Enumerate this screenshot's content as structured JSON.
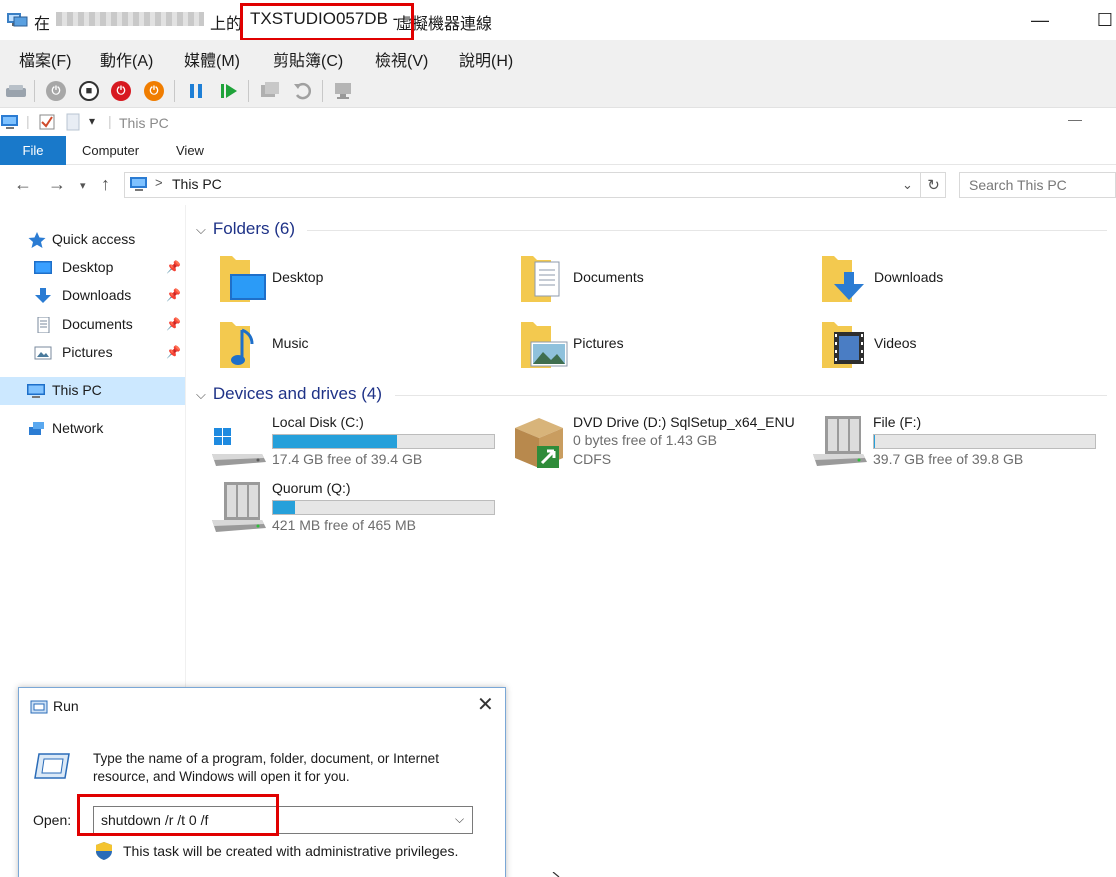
{
  "vm_window": {
    "title_prefix": "在",
    "title_on": "上的",
    "title_machine": "TXSTUDIO057DB -",
    "title_suffix": "虛擬機器連線",
    "minimize_glyph": "—",
    "maximize_glyph": "☐"
  },
  "vm_menu": [
    "檔案(F)",
    "動作(A)",
    "媒體(M)",
    "剪貼簿(C)",
    "檢視(V)",
    "說明(H)"
  ],
  "vm_toolbar": {
    "icons": [
      "ctrl-alt-del-icon",
      "start-icon",
      "turn-off-icon",
      "shutdown-icon",
      "power-icon",
      "pause-icon",
      "resume-icon",
      "checkpoint-icon",
      "revert-icon",
      "enhanced-session-icon"
    ],
    "colors": {
      "stop": "#d71920",
      "power": "#f07d00",
      "pause": "#1e7fd6",
      "resume": "#1fa33a"
    }
  },
  "explorer": {
    "qat_title": "This PC",
    "ribbon_tabs": {
      "file": "File",
      "computer": "Computer",
      "view": "View"
    },
    "address": "This PC",
    "address_separator": ">",
    "search_placeholder": "Search This PC",
    "nav": {
      "quick_access": "Quick access",
      "desktop": "Desktop",
      "downloads": "Downloads",
      "documents": "Documents",
      "pictures": "Pictures",
      "this_pc": "This PC",
      "network": "Network"
    },
    "folders_header": "Folders (6)",
    "folders": [
      "Desktop",
      "Documents",
      "Downloads",
      "Music",
      "Pictures",
      "Videos"
    ],
    "drives_header": "Devices and drives (4)",
    "drives": {
      "c": {
        "name": "Local Disk (C:)",
        "free": "17.4 GB free of 39.4 GB",
        "used_fraction": 0.56
      },
      "d": {
        "name": "DVD Drive (D:) SqlSetup_x64_ENU",
        "free": "0 bytes free of 1.43 GB",
        "fs": "CDFS"
      },
      "f": {
        "name": "File (F:)",
        "free": "39.7 GB free of 39.8 GB",
        "used_fraction": 0.003
      },
      "q": {
        "name": "Quorum (Q:)",
        "free": "421 MB free of 465 MB",
        "used_fraction": 0.1
      }
    }
  },
  "run_dialog": {
    "title": "Run",
    "description": "Type the name of a program, folder, document, or Internet resource, and Windows will open it for you.",
    "open_label": "Open:",
    "command": "shutdown /r /t 0 /f",
    "admin_note": "This task will be created with administrative privileges."
  }
}
